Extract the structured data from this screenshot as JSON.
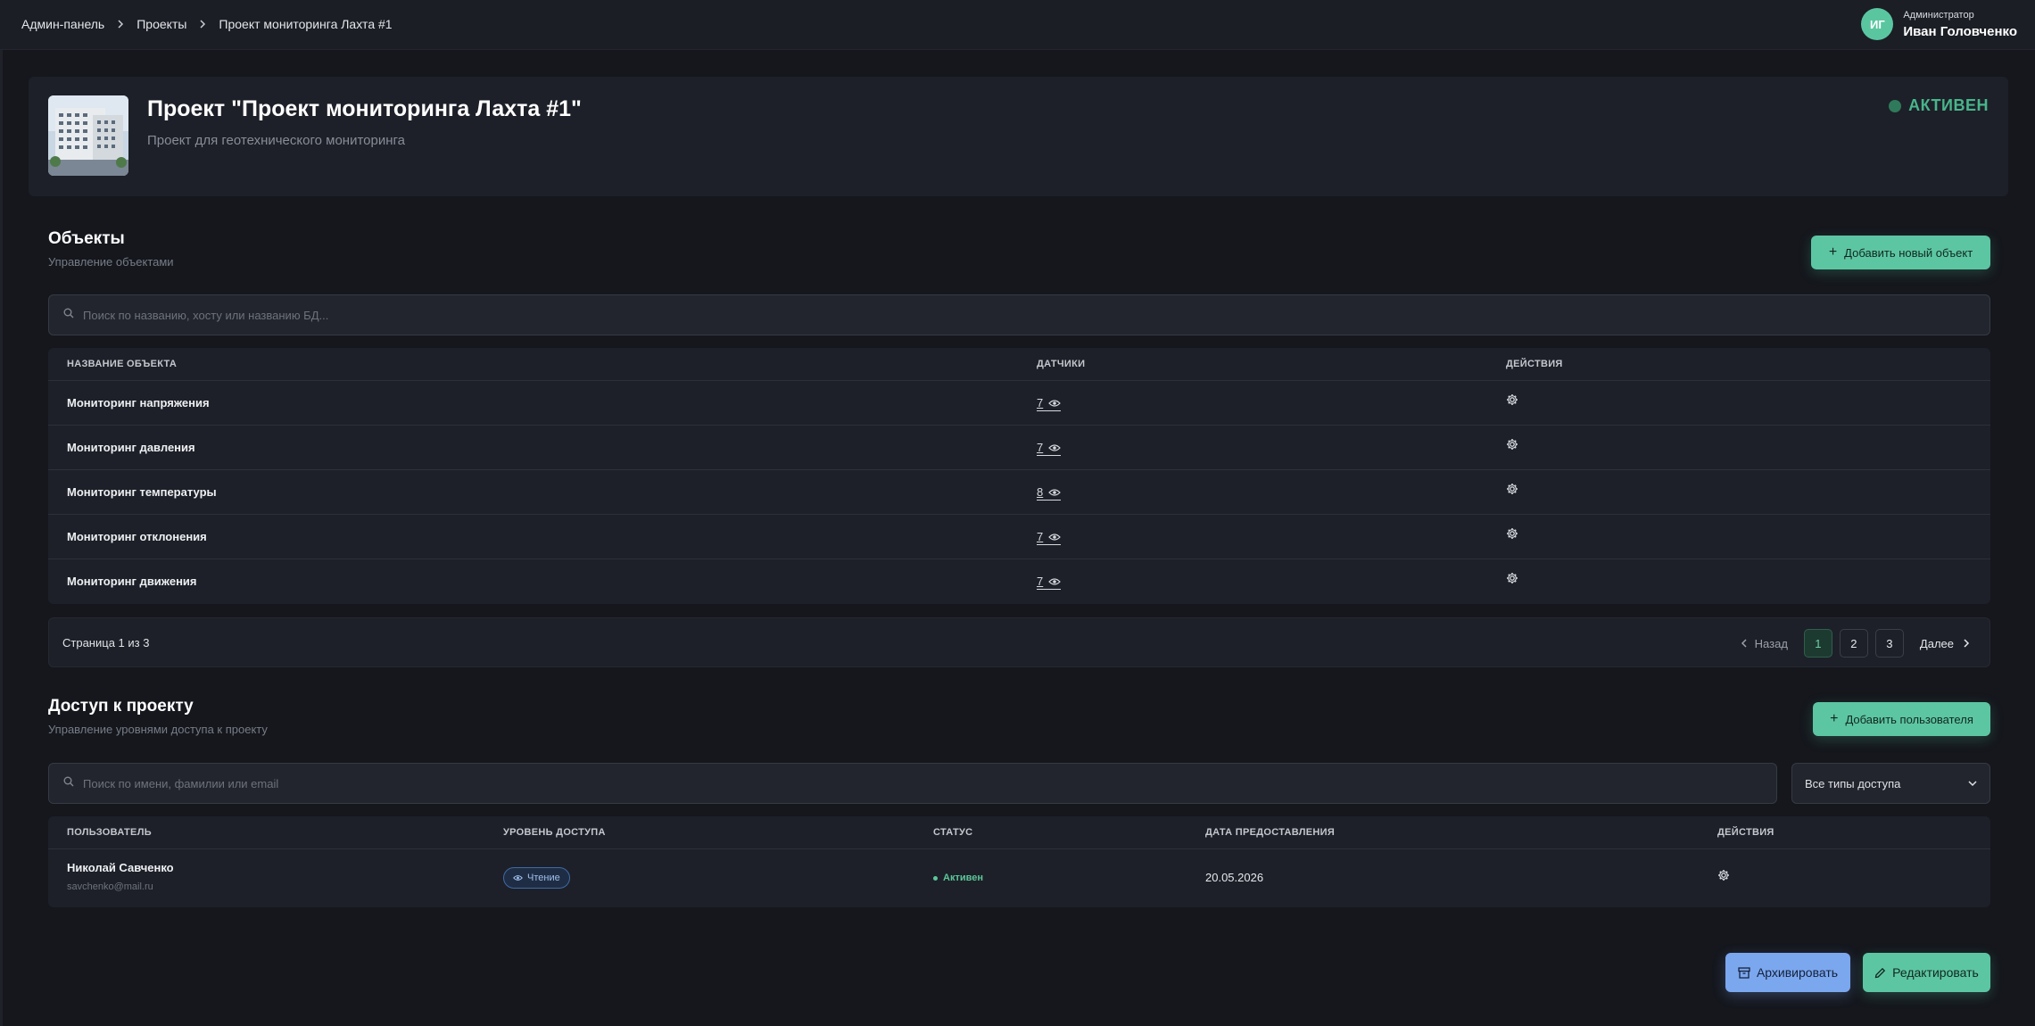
{
  "breadcrumb": {
    "items": [
      "Админ-панель",
      "Проекты",
      "Проект мониторинга Лахта #1"
    ]
  },
  "user": {
    "initials": "ИГ",
    "role": "Администратор",
    "name": "Иван Головченко"
  },
  "project": {
    "title": "Проект \"Проект мониторинга Лахта #1\"",
    "description": "Проект для геотехнического мониторинга",
    "status": "АКТИВЕН"
  },
  "objects": {
    "title": "Объекты",
    "subtitle": "Управление объектами",
    "add_button": "Добавить новый объект",
    "search_placeholder": "Поиск по названию, хосту или названию БД...",
    "columns": [
      "НАЗВАНИЕ ОБЪЕКТА",
      "ДАТЧИКИ",
      "ДЕЙСТВИЯ"
    ],
    "rows": [
      {
        "name": "Мониторинг напряжения",
        "sensors": "7"
      },
      {
        "name": "Мониторинг давления",
        "sensors": "7"
      },
      {
        "name": "Мониторинг температуры",
        "sensors": "8"
      },
      {
        "name": "Мониторинг отклонения",
        "sensors": "7"
      },
      {
        "name": "Мониторинг движения",
        "sensors": "7"
      }
    ]
  },
  "pagination": {
    "text": "Страница 1 из 3",
    "prev": "Назад",
    "next": "Далее",
    "pages": [
      "1",
      "2",
      "3"
    ],
    "current": "1"
  },
  "access": {
    "title": "Доступ к проекту",
    "subtitle": "Управление уровнями доступа к проекту",
    "add_button": "Добавить пользователя",
    "search_placeholder": "Поиск по имени, фамилии или email",
    "filter_value": "Все типы доступа",
    "columns": [
      "ПОЛЬЗОВАТЕЛЬ",
      "УРОВЕНЬ ДОСТУПА",
      "СТАТУС",
      "ДАТА ПРЕДОСТАВЛЕНИЯ",
      "ДЕЙСТВИЯ"
    ],
    "rows": [
      {
        "name": "Николай Савченко",
        "email": "savchenko@mail.ru",
        "level": "Чтение",
        "status": "Активен",
        "date": "20.05.2026"
      }
    ]
  },
  "footer": {
    "archive_button": "Архивировать",
    "edit_button": "Редактировать"
  },
  "colors": {
    "accent": "#5cc6a2",
    "blue": "#7ba7ef",
    "background": "#15171d",
    "card": "#1d2028"
  }
}
